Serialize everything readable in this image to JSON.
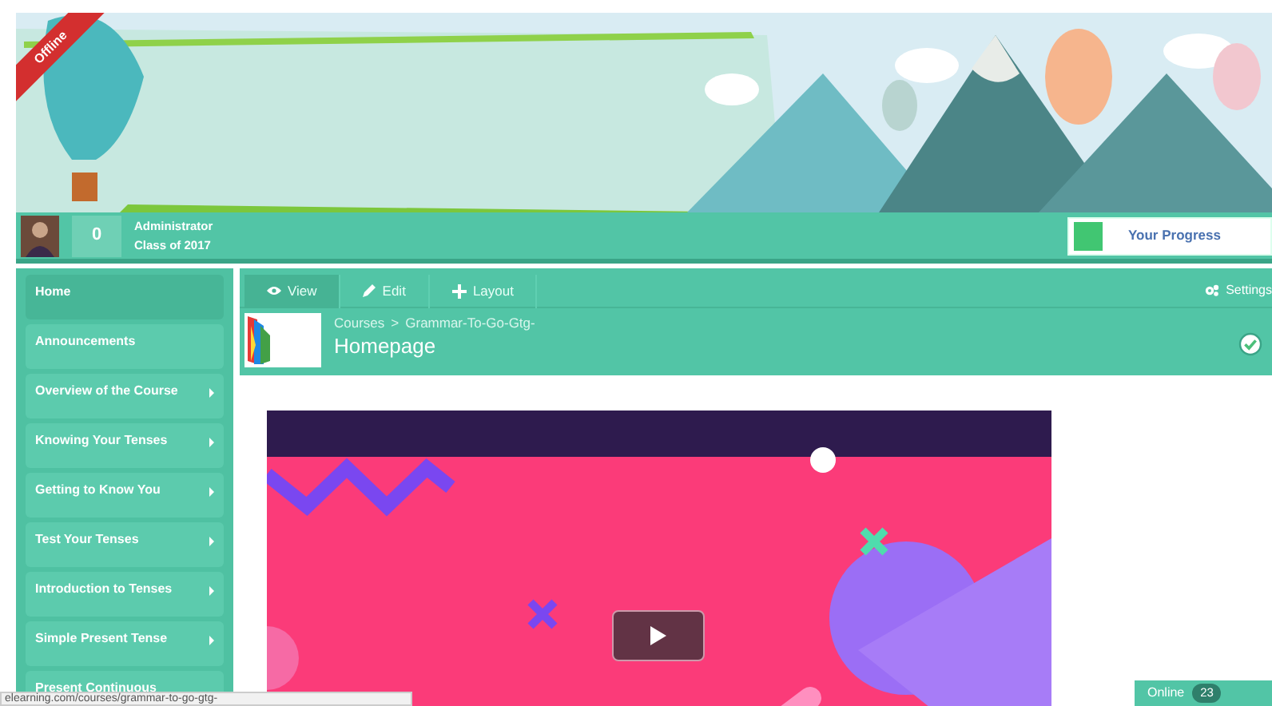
{
  "connection": {
    "label": "Offline",
    "offline": true
  },
  "user": {
    "points": "0",
    "name": "Administrator",
    "group": "Class of 2017"
  },
  "progress": {
    "label": "Your Progress"
  },
  "sidebar": {
    "items": [
      {
        "label": "Home",
        "selected": true,
        "has_submenu": false
      },
      {
        "label": "Announcements",
        "selected": false,
        "has_submenu": false
      },
      {
        "label": "Overview of the Course",
        "selected": false,
        "has_submenu": true
      },
      {
        "label": "Knowing Your Tenses",
        "selected": false,
        "has_submenu": true
      },
      {
        "label": "Getting to Know You",
        "selected": false,
        "has_submenu": true
      },
      {
        "label": "Test Your Tenses",
        "selected": false,
        "has_submenu": true
      },
      {
        "label": "Introduction to Tenses",
        "selected": false,
        "has_submenu": true
      },
      {
        "label": "Simple Present Tense",
        "selected": false,
        "has_submenu": true
      },
      {
        "label": "Present Continuous",
        "selected": false
      }
    ]
  },
  "toolbar": {
    "tabs": [
      {
        "label": "View",
        "kind": "eye",
        "selected": true
      },
      {
        "label": "Edit",
        "kind": "pencil",
        "selected": false
      },
      {
        "label": "Layout",
        "kind": "move",
        "selected": false
      }
    ],
    "settings": "Settings"
  },
  "page": {
    "breadcrumb": [
      "Courses",
      "Grammar-To-Go-Gtg-"
    ],
    "separator": ">",
    "title": "Homepage",
    "completed": true
  },
  "online": {
    "label": "Online",
    "count": "23"
  },
  "status_bar": {
    "url": "elearning.com/courses/grammar-to-go-gtg-"
  }
}
